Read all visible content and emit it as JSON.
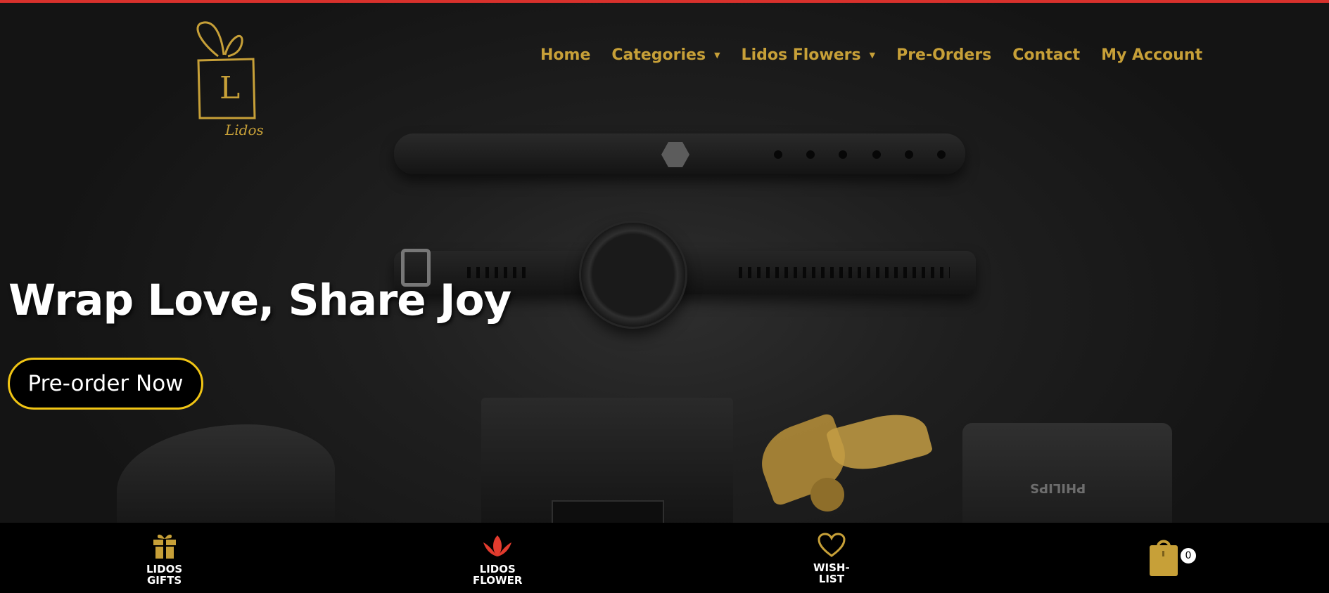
{
  "logo": {
    "letter": "L",
    "script_text": "Lidos"
  },
  "nav": {
    "items": [
      {
        "label": "Home",
        "has_dropdown": false
      },
      {
        "label": "Categories",
        "has_dropdown": true
      },
      {
        "label": "Lidos Flowers",
        "has_dropdown": true
      },
      {
        "label": "Pre-Orders",
        "has_dropdown": false
      },
      {
        "label": "Contact",
        "has_dropdown": false
      },
      {
        "label": "My Account",
        "has_dropdown": false
      }
    ],
    "caret": "▼"
  },
  "hero": {
    "title": "Wrap Love, Share Joy",
    "cta_label": "Pre-order Now",
    "product_text": "PHILIPS"
  },
  "bottom_bar": {
    "gifts_label": "LIDOS\nGIFTS",
    "flower_label": "LIDOS\nFLOWER",
    "wishlist_label": "WISH-\nLIST",
    "cart_count": "0"
  },
  "colors": {
    "accent_gold": "#c7a038",
    "top_line": "#d8312c",
    "cta_border": "#f1c514",
    "flower_red": "#e23b2e"
  },
  "icons": [
    "gift-icon",
    "lotus-icon",
    "heart-icon",
    "shopping-bag-icon",
    "chevron-down-icon"
  ]
}
